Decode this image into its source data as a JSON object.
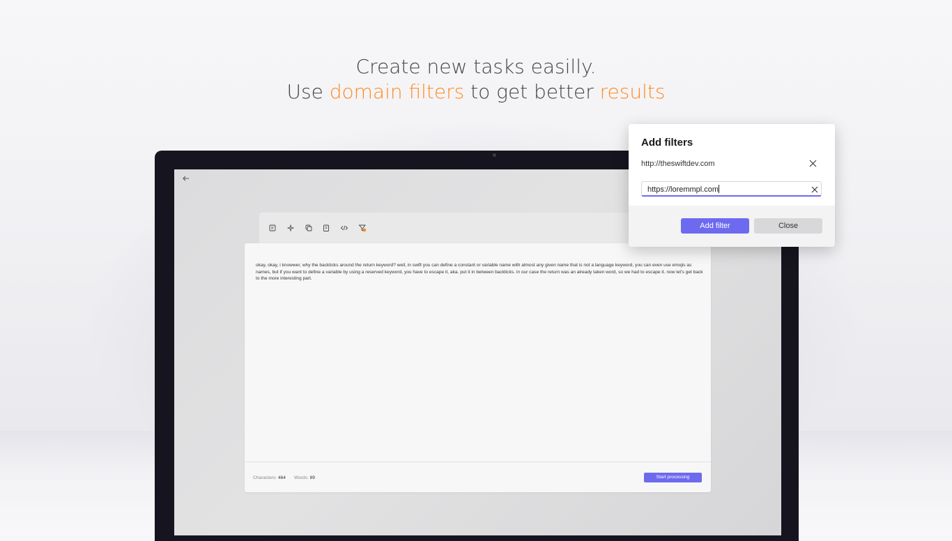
{
  "headline": {
    "line1": "Create new tasks easilly.",
    "line2_prefix": "Use ",
    "line2_accent1": "domain filters",
    "line2_middle": " to get better ",
    "line2_accent2": "results"
  },
  "colors": {
    "accent_orange": "#ff8a1f",
    "accent_purple": "#6d6af0",
    "laptop_bezel": "#16151f"
  },
  "app": {
    "back_icon": "arrow-left-icon",
    "toolbar_icons": [
      "note-icon",
      "sparkle-icon",
      "copy-icon",
      "clipboard-icon",
      "code-icon",
      "filter-icon"
    ],
    "editor_text": "okay, okay, i knowwer, why the backticks around the return keyword? well, in swift you can define a constant or variable name with almost any given name that is not a language keyword, you can even use emojis as names, but if you want to define a variable by using a reserved keyword, you have to escape it, aka. put it in between backticks. in our case the return was an already taken word, so we had to escape it. now let's get back to the more interesting part.",
    "stats": {
      "characters_label": "Characters:",
      "characters_value": "464",
      "words_label": "Words:",
      "words_value": "89"
    },
    "start_button": "Start processing"
  },
  "dialog": {
    "title": "Add filters",
    "filters": [
      {
        "url": "http://theswiftdev.com"
      }
    ],
    "input_value": "https://loremmpl.com",
    "add_button": "Add filter",
    "close_button": "Close"
  }
}
